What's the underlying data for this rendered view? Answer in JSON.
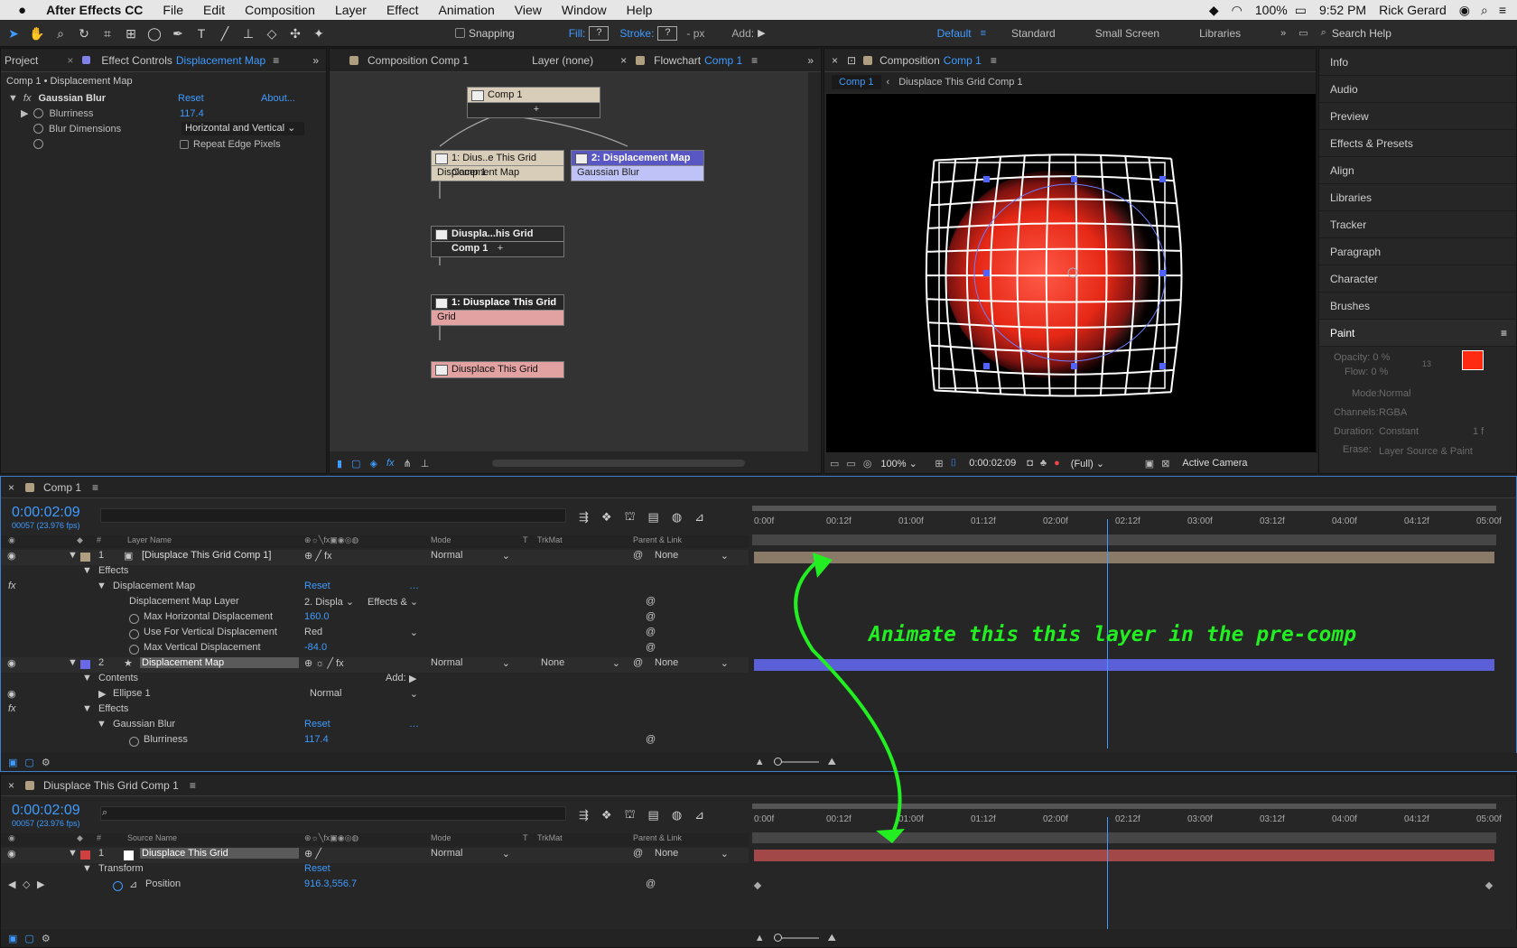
{
  "menubar": {
    "apple": "",
    "app": "After Effects CC",
    "items": [
      "File",
      "Edit",
      "Composition",
      "Layer",
      "Effect",
      "Animation",
      "View",
      "Window",
      "Help"
    ],
    "battery": "100%",
    "time": "9:52 PM",
    "user": "Rick Gerard"
  },
  "toolbar": {
    "snapping": "Snapping",
    "fill": "Fill:",
    "stroke": "Stroke:",
    "px": "- px",
    "add": "Add:",
    "workspaces": [
      "Default",
      "Standard",
      "Small Screen",
      "Libraries"
    ],
    "search": "Search Help"
  },
  "left_panel": {
    "tab_project": "Project",
    "tab_effect": "Effect Controls",
    "tab_effect_layer": "Displacement Map",
    "subtitle": "Comp 1 • Displacement Map",
    "effect": "Gaussian Blur",
    "reset": "Reset",
    "about": "About...",
    "blurriness_label": "Blurriness",
    "blurriness": "117.4",
    "blur_dim_label": "Blur Dimensions",
    "blur_dim": "Horizontal and Vertical",
    "repeat": "Repeat Edge Pixels"
  },
  "flow_panel": {
    "tab_comp": "Composition Comp 1",
    "tab_layer": "Layer (none)",
    "tab_flow": "Flowchart",
    "tab_flow_comp": "Comp 1",
    "nodes": {
      "comp1": "Comp 1",
      "n1_title": "1: Dius..e This Grid Comp 1",
      "n1_sub": "Displacement Map",
      "n2_title": "2: Displacement Map",
      "n2_sub": "Gaussian Blur",
      "pre_title": "Diuspla...his Grid Comp 1",
      "n3_title": "1: Diusplace This Grid",
      "n3_sub": "Grid",
      "src": "Diusplace This Grid"
    }
  },
  "viewer": {
    "tab": "Composition",
    "tab_comp": "Comp 1",
    "bc1": "Comp 1",
    "bc2": "Diusplace This Grid Comp 1",
    "zoom": "100%",
    "time": "0:00:02:09",
    "res": "(Full)",
    "camera": "Active Camera"
  },
  "right_panel": {
    "items": [
      "Info",
      "Audio",
      "Preview",
      "Effects & Presets",
      "Align",
      "Libraries",
      "Tracker",
      "Paragraph",
      "Character",
      "Brushes"
    ],
    "paint": "Paint",
    "opacity": "Opacity: 0 %",
    "flow": "Flow: 0 %",
    "mode_l": "Mode:",
    "mode": "Normal",
    "chan_l": "Channels:",
    "chan": "RGBA",
    "dur_l": "Duration:",
    "dur": "Constant",
    "dur_v": "1 f",
    "erase_l": "Erase:",
    "erase": "Layer Source & Paint",
    "n13": "13",
    "fg_color": "#ff2a12"
  },
  "timeline1": {
    "tab": "Comp 1",
    "time": "0:00:02:09",
    "fps": "00057 (23.976 fps)",
    "col_name": "Layer Name",
    "col_mode": "Mode",
    "col_t": "T",
    "col_trk": "TrkMat",
    "col_parent": "Parent & Link",
    "ticks": [
      "0:00f",
      "00:12f",
      "01:00f",
      "01:12f",
      "02:00f",
      "02:12f",
      "03:00f",
      "03:12f",
      "04:00f",
      "04:12f",
      "05:00f"
    ],
    "rows": {
      "l1_num": "1",
      "l1_name": "[Diusplace This Grid Comp 1]",
      "l1_mode": "Normal",
      "l1_parent": "None",
      "effects": "Effects",
      "dm": "Displacement Map",
      "reset": "Reset",
      "dml": "Displacement Map Layer",
      "dml_v": "2. Displa",
      "dml_v2": "Effects &",
      "mhd": "Max Horizontal Displacement",
      "mhd_v": "160.0",
      "uvd": "Use For Vertical Displacement",
      "uvd_v": "Red",
      "mvd": "Max Vertical Displacement",
      "mvd_v": "-84.0",
      "l2_num": "2",
      "l2_name": "Displacement Map",
      "l2_mode": "Normal",
      "l2_trk": "None",
      "l2_parent": "None",
      "contents": "Contents",
      "add": "Add:",
      "ellipse": "Ellipse 1",
      "ellipse_mode": "Normal",
      "effects2": "Effects",
      "gb": "Gaussian Blur",
      "blur": "Blurriness",
      "blur_v": "117.4"
    }
  },
  "annotation": "Animate this this layer in the pre-comp",
  "timeline2": {
    "tab": "Diusplace This Grid Comp 1",
    "time": "0:00:02:09",
    "fps": "00057 (23.976 fps)",
    "col_name": "Source Name",
    "col_mode": "Mode",
    "col_t": "T",
    "col_trk": "TrkMat",
    "col_parent": "Parent & Link",
    "rows": {
      "l1_num": "1",
      "l1_name": "Diusplace This Grid",
      "l1_mode": "Normal",
      "l1_parent": "None",
      "transform": "Transform",
      "reset": "Reset",
      "position": "Position",
      "position_v": "916.3,556.7"
    }
  },
  "playhead_fraction": 0.476
}
